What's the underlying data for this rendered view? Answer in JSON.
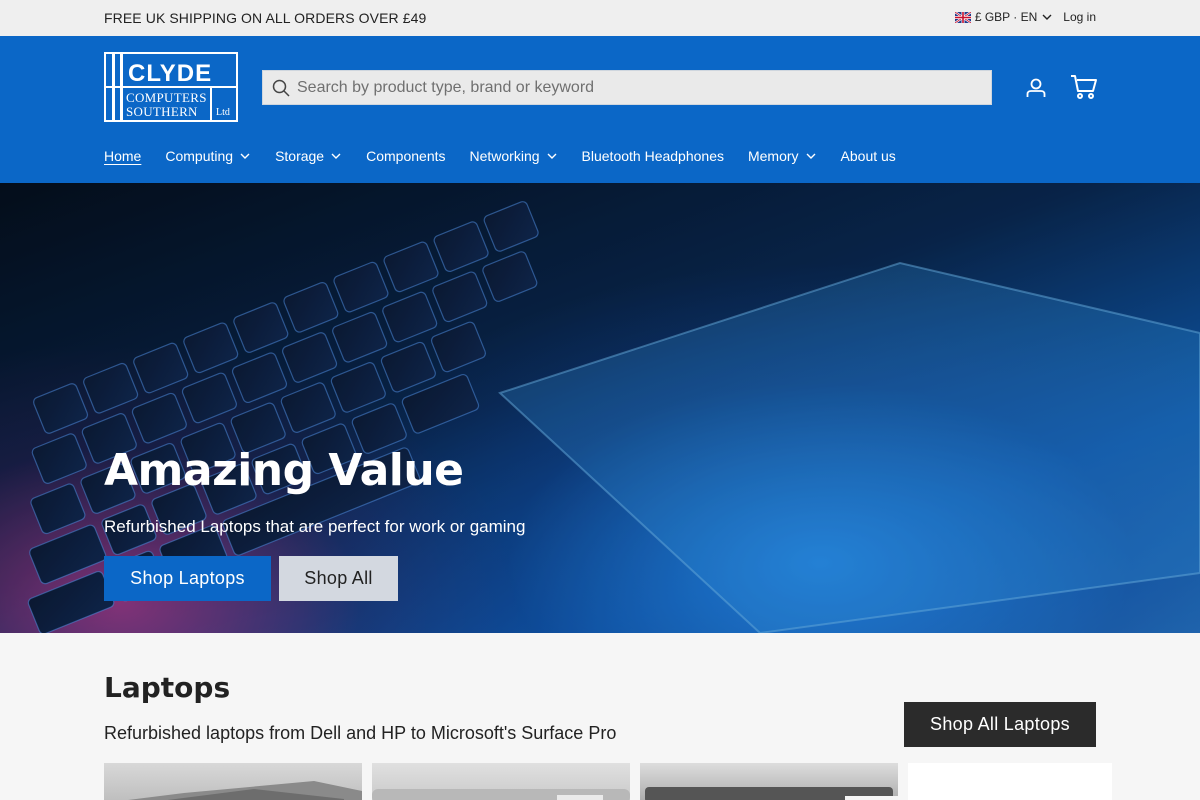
{
  "announcement": {
    "message": "FREE UK SHIPPING ON ALL ORDERS OVER £49",
    "locale": "£ GBP · EN",
    "login": "Log in"
  },
  "header": {
    "logo": {
      "line1": "CLYDE",
      "line2": "COMPUTERS",
      "line3": "SOUTHERN",
      "suffix": "Ltd"
    },
    "search_placeholder": "Search by product type, brand or keyword",
    "brand_color": "#0b67c7"
  },
  "nav": {
    "items": [
      {
        "label": "Home",
        "dropdown": false
      },
      {
        "label": "Computing",
        "dropdown": true
      },
      {
        "label": "Storage",
        "dropdown": true
      },
      {
        "label": "Components",
        "dropdown": false
      },
      {
        "label": "Networking",
        "dropdown": true
      },
      {
        "label": "Bluetooth Headphones",
        "dropdown": false
      },
      {
        "label": "Memory",
        "dropdown": true
      },
      {
        "label": "About us",
        "dropdown": false
      }
    ]
  },
  "hero": {
    "title": "Amazing Value",
    "subtitle": "Refurbished Laptops that are perfect for work or gaming",
    "primary_button": "Shop Laptops",
    "secondary_button": "Shop All"
  },
  "laptops": {
    "title": "Laptops",
    "subtitle": "Refurbished laptops from Dell and HP to Microsoft's Surface Pro",
    "button": "Shop All Laptops"
  }
}
